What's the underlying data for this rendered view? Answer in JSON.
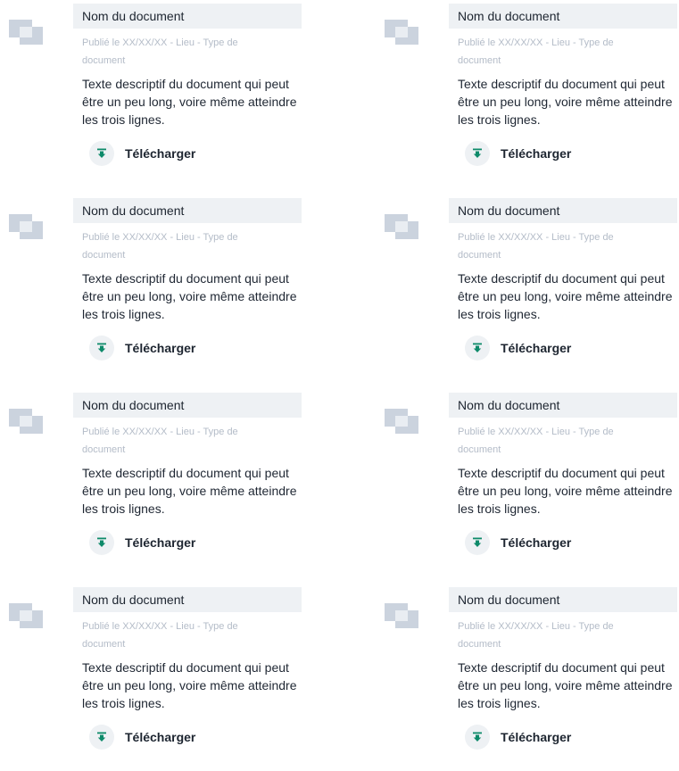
{
  "colors": {
    "title_bg": "#eef1f4",
    "thumb": "#cbd3de",
    "meta_text": "#b4bcc8",
    "body_text": "#1f2733",
    "download_icon": "#0e8a6a"
  },
  "documents": [
    {
      "title": "Nom du document",
      "meta_line1": "Publié le XX/XX/XX - Lieu - Type de",
      "meta_line2": "document",
      "desc": "Texte descriptif du document qui peut être un peu long, voire même atteindre les trois lignes.",
      "download_label": "Télécharger",
      "download_icon": "download-icon"
    },
    {
      "title": "Nom du document",
      "meta_line1": "Publié le XX/XX/XX - Lieu - Type de",
      "meta_line2": "document",
      "desc": "Texte descriptif du document qui peut être un peu long, voire même atteindre les trois lignes.",
      "download_label": "Télécharger",
      "download_icon": "download-icon"
    },
    {
      "title": "Nom du document",
      "meta_line1": "Publié le XX/XX/XX - Lieu - Type de",
      "meta_line2": "document",
      "desc": "Texte descriptif du document qui peut être un peu long, voire même atteindre les trois lignes.",
      "download_label": "Télécharger",
      "download_icon": "download-icon"
    },
    {
      "title": "Nom du document",
      "meta_line1": "Publié le XX/XX/XX - Lieu - Type de",
      "meta_line2": "document",
      "desc": "Texte descriptif du document qui peut être un peu long, voire même atteindre les trois lignes.",
      "download_label": "Télécharger",
      "download_icon": "download-icon"
    },
    {
      "title": "Nom du document",
      "meta_line1": "Publié le XX/XX/XX - Lieu - Type de",
      "meta_line2": "document",
      "desc": "Texte descriptif du document qui peut être un peu long, voire même atteindre les trois lignes.",
      "download_label": "Télécharger",
      "download_icon": "download-icon"
    },
    {
      "title": "Nom du document",
      "meta_line1": "Publié le XX/XX/XX - Lieu - Type de",
      "meta_line2": "document",
      "desc": "Texte descriptif du document qui peut être un peu long, voire même atteindre les trois lignes.",
      "download_label": "Télécharger",
      "download_icon": "download-icon"
    },
    {
      "title": "Nom du document",
      "meta_line1": "Publié le XX/XX/XX - Lieu - Type de",
      "meta_line2": "document",
      "desc": "Texte descriptif du document qui peut être un peu long, voire même atteindre les trois lignes.",
      "download_label": "Télécharger",
      "download_icon": "download-icon"
    },
    {
      "title": "Nom du document",
      "meta_line1": "Publié le XX/XX/XX - Lieu - Type de",
      "meta_line2": "document",
      "desc": "Texte descriptif du document qui peut être un peu long, voire même atteindre les trois lignes.",
      "download_label": "Télécharger",
      "download_icon": "download-icon"
    }
  ]
}
